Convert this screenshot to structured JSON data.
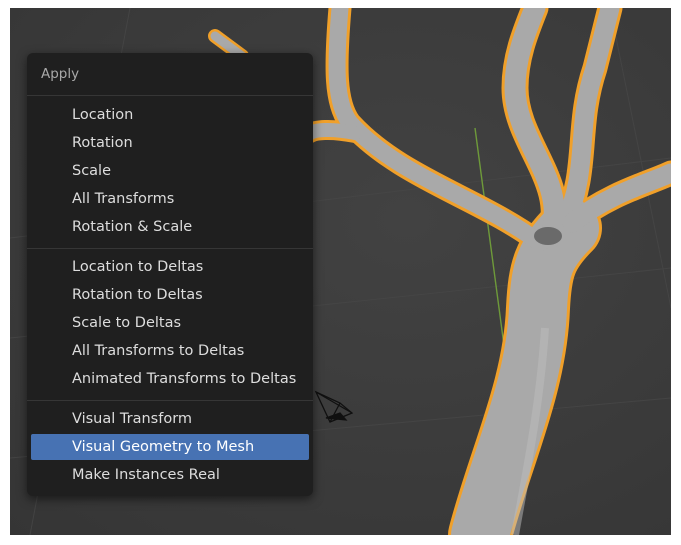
{
  "menu": {
    "title": "Apply",
    "items": [
      {
        "label": "Location"
      },
      {
        "label": "Rotation"
      },
      {
        "label": "Scale"
      },
      {
        "label": "All Transforms"
      },
      {
        "label": "Rotation & Scale"
      },
      {
        "label": "Location to Deltas"
      },
      {
        "label": "Rotation to Deltas"
      },
      {
        "label": "Scale to Deltas"
      },
      {
        "label": "All Transforms to Deltas"
      },
      {
        "label": "Animated Transforms to Deltas"
      },
      {
        "label": "Visual Transform"
      },
      {
        "label": "Visual Geometry to Mesh"
      },
      {
        "label": "Make Instances Real"
      }
    ],
    "active_item": "Visual Geometry to Mesh"
  },
  "colors": {
    "menu_background": "#1f1f1f",
    "highlight": "#4772b3",
    "selection_outline": "#f0a02a",
    "mesh": "#a9a9a9",
    "viewport_background": "#3c3c3c",
    "y_axis": "#6e9a3a"
  },
  "icons": {
    "camera": "camera-object-icon"
  }
}
